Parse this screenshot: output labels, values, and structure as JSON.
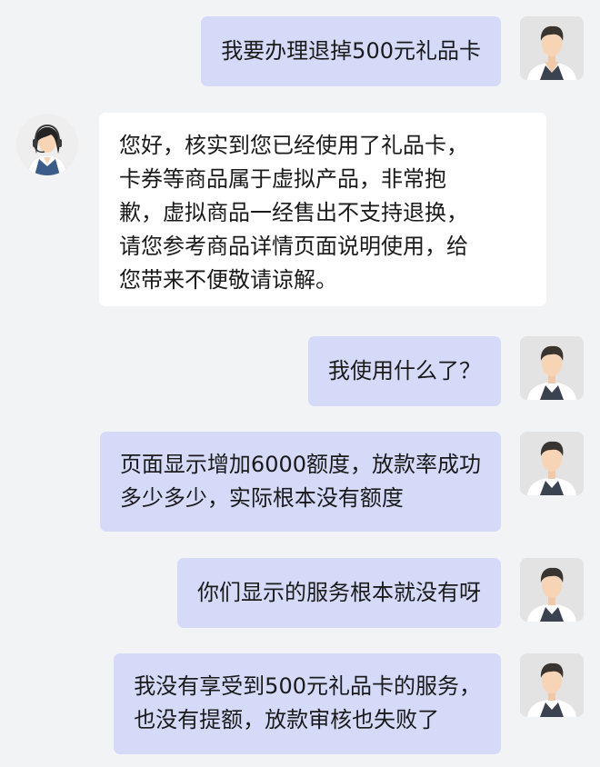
{
  "messages": [
    {
      "sender": "user",
      "lines": [
        "我要办理退掉500元礼品卡"
      ]
    },
    {
      "sender": "agent",
      "lines": [
        "您好，核实到您已经使用了礼品卡，",
        "卡券等商品属于虚拟产品，非常抱",
        "歉，虚拟商品一经售出不支持退换，",
        "请您参考商品详情页面说明使用，给",
        "您带来不便敬请谅解。"
      ]
    },
    {
      "sender": "user",
      "lines": [
        "我使用什么了？"
      ]
    },
    {
      "sender": "user",
      "lines": [
        "页面显示增加6000额度，放款率成功",
        "多少多少，实际根本没有额度"
      ]
    },
    {
      "sender": "user",
      "lines": [
        "你们显示的服务根本就没有呀"
      ]
    },
    {
      "sender": "user",
      "lines": [
        "我没有享受到500元礼品卡的服务，",
        "也没有提额，放款审核也失败了"
      ]
    }
  ],
  "icons": {
    "user_avatar": "user-avatar-icon",
    "agent_avatar": "customer-service-agent-icon"
  },
  "colors": {
    "background": "#f2f3f5",
    "user_bubble": "#d4daf8",
    "agent_bubble": "#ffffff"
  }
}
